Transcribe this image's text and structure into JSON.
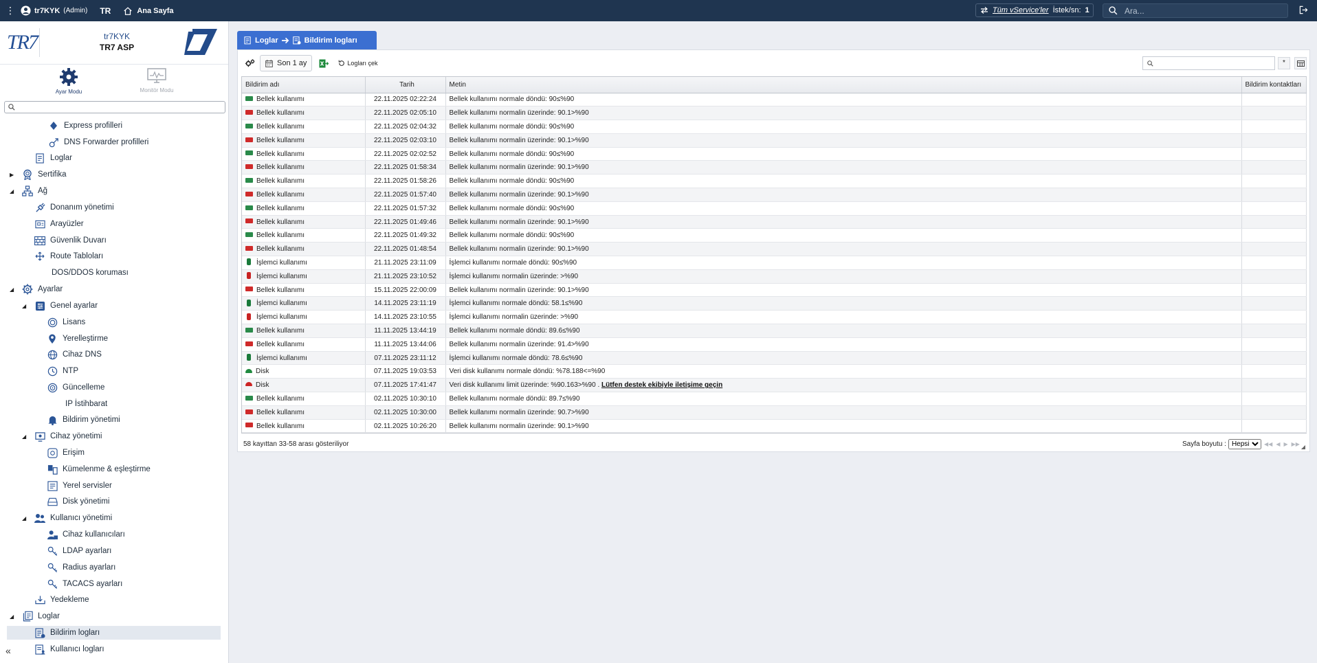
{
  "topbar": {
    "username": "tr7KYK",
    "role": "(Admin)",
    "language": "TR",
    "home_label": "Ana Sayfa",
    "service_link": "Tüm vService'ler",
    "rate_label": "İstek/sn:",
    "rate_value": "1",
    "search_placeholder": "Ara...",
    "icons": [
      "kebab-icon",
      "user-icon",
      "home-icon",
      "swap-icon",
      "search-icon",
      "logout-icon"
    ]
  },
  "sidebar": {
    "org": "tr7KYK",
    "app": "TR7 ASP",
    "logo_left": "TR7",
    "modes": {
      "settings": "Ayar Modu",
      "monitor": "Monitör Modu"
    },
    "search_placeholder": "",
    "items": [
      {
        "label": "Express profilleri",
        "icon": "diamond-icon"
      },
      {
        "label": "DNS Forwarder profilleri",
        "icon": "forward-icon"
      },
      {
        "label": "Loglar",
        "icon": "log-icon"
      },
      {
        "label": "Sertifika",
        "icon": "certificate-icon"
      },
      {
        "label": "Ağ",
        "icon": "network-icon"
      },
      {
        "label": "Donanım yönetimi",
        "icon": "hardware-icon"
      },
      {
        "label": "Arayüzler",
        "icon": "interface-icon"
      },
      {
        "label": "Güvenlik Duvarı",
        "icon": "firewall-icon"
      },
      {
        "label": "Route Tabloları",
        "icon": "route-icon"
      },
      {
        "label": "DOS/DDOS koruması",
        "icon": ""
      },
      {
        "label": "Ayarlar",
        "icon": "settings-icon"
      },
      {
        "label": "Genel ayarlar",
        "icon": "general-settings-icon"
      },
      {
        "label": "Lisans",
        "icon": "license-icon"
      },
      {
        "label": "Yerelleştirme",
        "icon": "location-icon"
      },
      {
        "label": "Cihaz DNS",
        "icon": "dns-icon"
      },
      {
        "label": "NTP",
        "icon": "clock-icon"
      },
      {
        "label": "Güncelleme",
        "icon": "update-icon"
      },
      {
        "label": "IP İstihbarat",
        "icon": ""
      },
      {
        "label": "Bildirim yönetimi",
        "icon": "bell-icon"
      },
      {
        "label": "Cihaz yönetimi",
        "icon": "device-icon"
      },
      {
        "label": "Erişim",
        "icon": "access-icon"
      },
      {
        "label": "Kümelenme & eşleştirme",
        "icon": "cluster-icon"
      },
      {
        "label": "Yerel servisler",
        "icon": "service-icon"
      },
      {
        "label": "Disk yönetimi",
        "icon": "disk-icon"
      },
      {
        "label": "Kullanıcı yönetimi",
        "icon": "users-icon"
      },
      {
        "label": "Cihaz kullanıcıları",
        "icon": "device-users-icon"
      },
      {
        "label": "LDAP ayarları",
        "icon": "key-icon"
      },
      {
        "label": "Radius ayarları",
        "icon": "key-icon"
      },
      {
        "label": "TACACS ayarları",
        "icon": "key-icon"
      },
      {
        "label": "Yedekleme",
        "icon": "backup-icon"
      },
      {
        "label": "Loglar",
        "icon": "logs-icon"
      },
      {
        "label": "Bildirim logları",
        "icon": "notification-log-icon"
      },
      {
        "label": "Kullanıcı logları",
        "icon": "user-log-icon"
      }
    ],
    "collapse_label": "«"
  },
  "breadcrumb": {
    "parent": "Loglar",
    "current": "Bildirim logları"
  },
  "toolbar": {
    "range_label": "Son 1 ay",
    "fetch_label": "Logları çek",
    "search_placeholder": "",
    "clear_label": "*"
  },
  "table": {
    "columns": [
      "Bildirim adı",
      "Tarih",
      "Metin",
      "Bildirim kontaktları"
    ],
    "rows": [
      {
        "status": "ok-mem",
        "name": "Bellek kullanımı",
        "date": "22.11.2025 02:22:24",
        "text": "Bellek kullanımı normale döndü: 90≤%90",
        "link": ""
      },
      {
        "status": "bad-mem",
        "name": "Bellek kullanımı",
        "date": "22.11.2025 02:05:10",
        "text": "Bellek kullanımı normalin üzerinde: 90.1>%90",
        "link": ""
      },
      {
        "status": "ok-mem",
        "name": "Bellek kullanımı",
        "date": "22.11.2025 02:04:32",
        "text": "Bellek kullanımı normale döndü: 90≤%90",
        "link": ""
      },
      {
        "status": "bad-mem",
        "name": "Bellek kullanımı",
        "date": "22.11.2025 02:03:10",
        "text": "Bellek kullanımı normalin üzerinde: 90.1>%90",
        "link": ""
      },
      {
        "status": "ok-mem",
        "name": "Bellek kullanımı",
        "date": "22.11.2025 02:02:52",
        "text": "Bellek kullanımı normale döndü: 90≤%90",
        "link": ""
      },
      {
        "status": "bad-mem",
        "name": "Bellek kullanımı",
        "date": "22.11.2025 01:58:34",
        "text": "Bellek kullanımı normalin üzerinde: 90.1>%90",
        "link": ""
      },
      {
        "status": "ok-mem",
        "name": "Bellek kullanımı",
        "date": "22.11.2025 01:58:26",
        "text": "Bellek kullanımı normale döndü: 90≤%90",
        "link": ""
      },
      {
        "status": "bad-mem",
        "name": "Bellek kullanımı",
        "date": "22.11.2025 01:57:40",
        "text": "Bellek kullanımı normalin üzerinde: 90.1>%90",
        "link": ""
      },
      {
        "status": "ok-mem",
        "name": "Bellek kullanımı",
        "date": "22.11.2025 01:57:32",
        "text": "Bellek kullanımı normale döndü: 90≤%90",
        "link": ""
      },
      {
        "status": "bad-mem",
        "name": "Bellek kullanımı",
        "date": "22.11.2025 01:49:46",
        "text": "Bellek kullanımı normalin üzerinde: 90.1>%90",
        "link": ""
      },
      {
        "status": "ok-mem",
        "name": "Bellek kullanımı",
        "date": "22.11.2025 01:49:32",
        "text": "Bellek kullanımı normale döndü: 90≤%90",
        "link": ""
      },
      {
        "status": "bad-mem",
        "name": "Bellek kullanımı",
        "date": "22.11.2025 01:48:54",
        "text": "Bellek kullanımı normalin üzerinde: 90.1>%90",
        "link": ""
      },
      {
        "status": "ok-cpu",
        "name": "İşlemci kullanımı",
        "date": "21.11.2025 23:11:09",
        "text": "İşlemci kullanımı normale döndü: 90≤%90",
        "link": ""
      },
      {
        "status": "bad-cpu",
        "name": "İşlemci kullanımı",
        "date": "21.11.2025 23:10:52",
        "text": "İşlemci kullanımı normalin üzerinde: >%90",
        "link": ""
      },
      {
        "status": "bad-mem",
        "name": "Bellek kullanımı",
        "date": "15.11.2025 22:00:09",
        "text": "Bellek kullanımı normalin üzerinde: 90.1>%90",
        "link": ""
      },
      {
        "status": "ok-cpu",
        "name": "İşlemci kullanımı",
        "date": "14.11.2025 23:11:19",
        "text": "İşlemci kullanımı normale döndü: 58.1≤%90",
        "link": ""
      },
      {
        "status": "bad-cpu",
        "name": "İşlemci kullanımı",
        "date": "14.11.2025 23:10:55",
        "text": "İşlemci kullanımı normalin üzerinde: >%90",
        "link": ""
      },
      {
        "status": "ok-mem",
        "name": "Bellek kullanımı",
        "date": "11.11.2025 13:44:19",
        "text": "Bellek kullanımı normale döndü: 89.6≤%90",
        "link": ""
      },
      {
        "status": "bad-mem",
        "name": "Bellek kullanımı",
        "date": "11.11.2025 13:44:06",
        "text": "Bellek kullanımı normalin üzerinde: 91.4>%90",
        "link": ""
      },
      {
        "status": "ok-cpu",
        "name": "İşlemci kullanımı",
        "date": "07.11.2025 23:11:12",
        "text": "İşlemci kullanımı normale döndü: 78.6≤%90",
        "link": ""
      },
      {
        "status": "ok-disk",
        "name": "Disk",
        "date": "07.11.2025 19:03:53",
        "text": "Veri disk kullanımı normale döndü: %78.188<=%90",
        "link": ""
      },
      {
        "status": "bad-disk",
        "name": "Disk",
        "date": "07.11.2025 17:41:47",
        "text": "Veri disk kullanımı limit üzerinde: %90.163>%90 . ",
        "link": "Lütfen destek ekibiyle iletişime geçin"
      },
      {
        "status": "ok-mem",
        "name": "Bellek kullanımı",
        "date": "02.11.2025 10:30:10",
        "text": "Bellek kullanımı normale döndü: 89.7≤%90",
        "link": ""
      },
      {
        "status": "bad-mem",
        "name": "Bellek kullanımı",
        "date": "02.11.2025 10:30:00",
        "text": "Bellek kullanımı normalin üzerinde: 90.7>%90",
        "link": ""
      },
      {
        "status": "bad-mem",
        "name": "Bellek kullanımı",
        "date": "02.11.2025 10:26:20",
        "text": "Bellek kullanımı normalin üzerinde: 90.1>%90",
        "link": ""
      }
    ]
  },
  "footer": {
    "info": "58 kayıttan 33-58 arası gösteriliyor",
    "page_size_label": "Sayfa boyutu :",
    "page_size_value": "Hepsi"
  },
  "colors": {
    "topbar": "#1f3550",
    "accent": "#3b6fd1",
    "ok": "#2a8a4a",
    "alert": "#cf2a2a"
  }
}
